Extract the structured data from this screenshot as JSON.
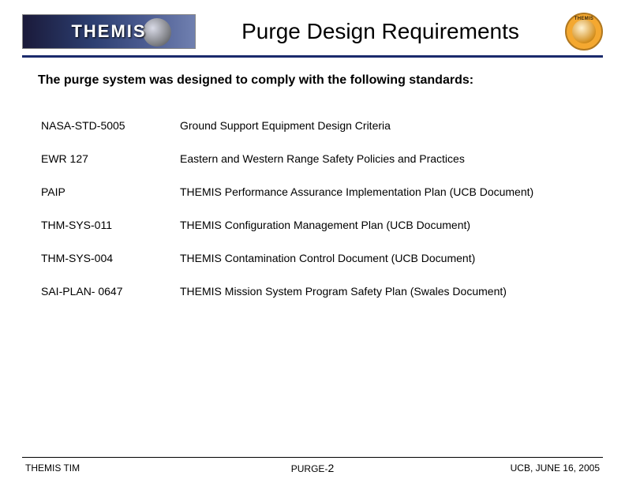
{
  "header": {
    "logo_text": "THEMIS",
    "title": "Purge Design Requirements"
  },
  "intro": "The purge system was designed to comply with the following standards:",
  "standards": [
    {
      "code": "NASA-STD-5005",
      "desc": "Ground Support Equipment Design Criteria"
    },
    {
      "code": "EWR 127",
      "desc": "Eastern and Western Range Safety Policies and Practices"
    },
    {
      "code": "PAIP",
      "desc": "THEMIS Performance Assurance Implementation Plan (UCB Document)"
    },
    {
      "code": "THM-SYS-011",
      "desc": "THEMIS Configuration Management Plan (UCB Document)"
    },
    {
      "code": "THM-SYS-004",
      "desc": "THEMIS Contamination Control Document (UCB Document)"
    },
    {
      "code": "SAI-PLAN- 0647",
      "desc": "THEMIS Mission System Program Safety Plan (Swales Document)"
    }
  ],
  "footer": {
    "left": "THEMIS TIM",
    "center_prefix": "PURGE-",
    "page_num": "2",
    "right": "UCB, JUNE 16, 2005"
  }
}
